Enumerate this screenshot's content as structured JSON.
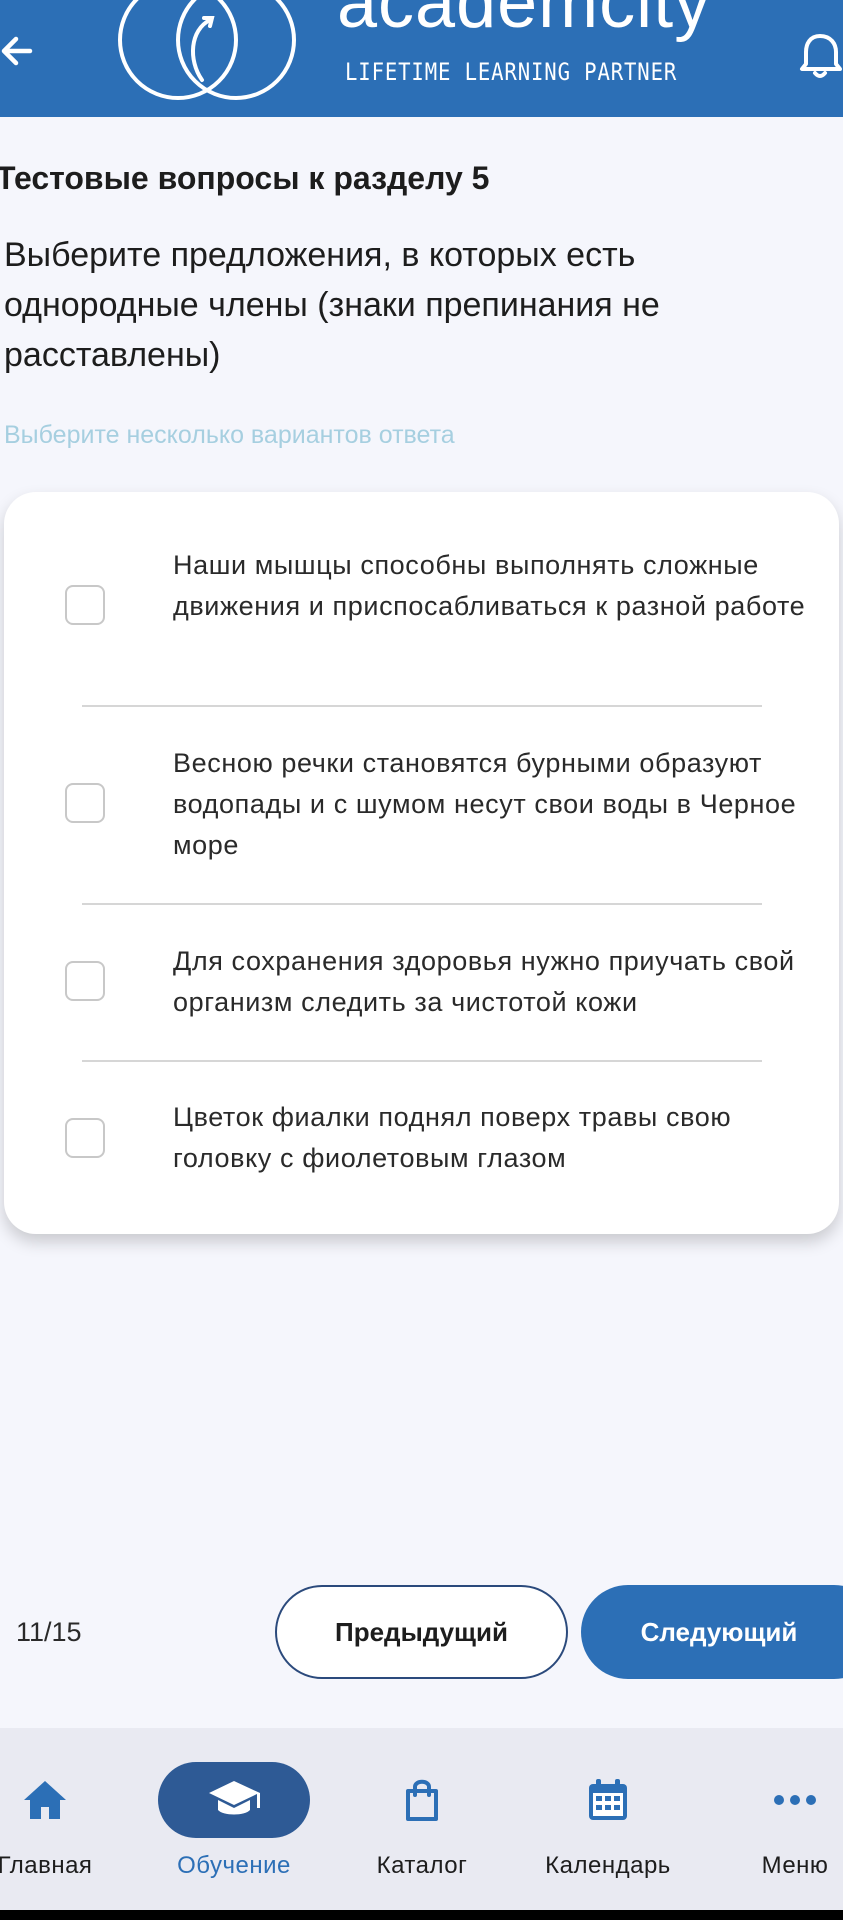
{
  "header": {
    "brand": "academcity",
    "tagline": "LIFETIME LEARNING PARTNER"
  },
  "colors": {
    "primary": "#2c6fb6",
    "hint": "#a6cfe0",
    "nav_active": "#2e5a95"
  },
  "quiz": {
    "section_title": "Тестовые вопросы к разделу 5",
    "question": "Выберите предложения, в которых есть однородные члены (знаки препинания не расставлены)",
    "hint": "Выберите несколько вариантов ответа",
    "options": [
      {
        "text": "Наши мышцы способны выполнять сложные движения и приспосабливаться к разной работе",
        "checked": false
      },
      {
        "text": "Весною речки становятся бурными образуют водопады и с шумом несут свои воды в Черное море",
        "checked": false
      },
      {
        "text": "Для сохранения здоровья нужно приучать свой организм следить за чистотой кожи",
        "checked": false
      },
      {
        "text": "Цветок фиалки поднял поверх травы свою головку с фиолетовым глазом",
        "checked": false
      }
    ]
  },
  "pager": {
    "counter": "11/15",
    "prev_label": "Предыдущий",
    "next_label": "Следующий"
  },
  "nav": {
    "items": [
      {
        "label": "Главная",
        "icon": "home-icon"
      },
      {
        "label": "Обучение",
        "icon": "graduation-cap-icon",
        "active": true
      },
      {
        "label": "Каталог",
        "icon": "shopping-bag-icon"
      },
      {
        "label": "Календарь",
        "icon": "calendar-icon"
      },
      {
        "label": "Меню",
        "icon": "more-horizontal-icon"
      }
    ]
  }
}
